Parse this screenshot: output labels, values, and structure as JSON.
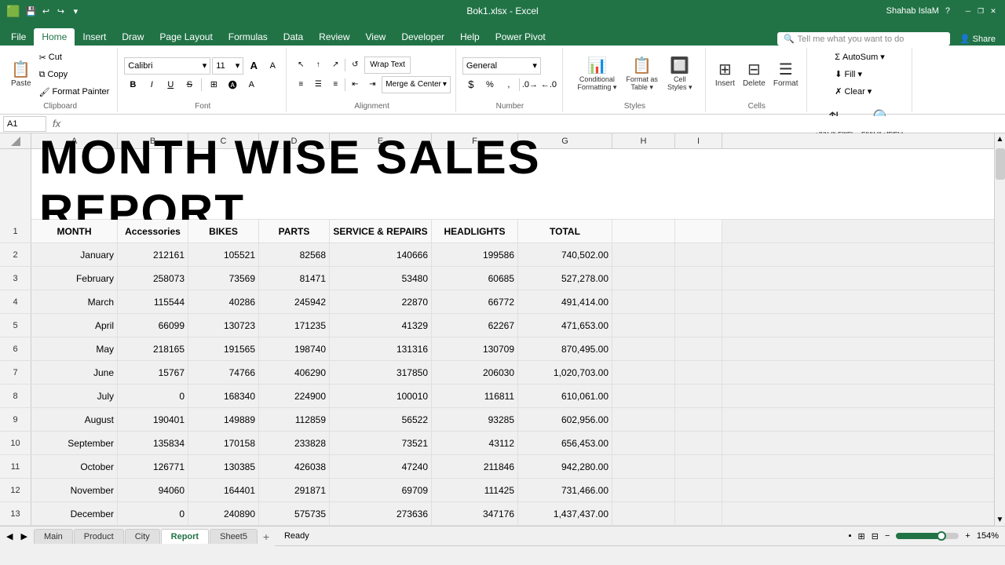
{
  "titlebar": {
    "filename": "Bok1.xlsx - Excel",
    "user": "Shahab IslaM",
    "quickaccess": [
      "save",
      "undo",
      "redo",
      "customize"
    ]
  },
  "ribbon": {
    "tabs": [
      "File",
      "Home",
      "Insert",
      "Draw",
      "Page Layout",
      "Formulas",
      "Data",
      "Review",
      "View",
      "Developer",
      "Help",
      "Power Pivot"
    ],
    "active_tab": "Home",
    "search_placeholder": "Tell me what you want to do",
    "share": "Share",
    "font": {
      "name": "Calibri",
      "size": "11",
      "grow": "A",
      "shrink": "A"
    },
    "clipboard": {
      "paste": "Paste",
      "cut": "Cut",
      "copy": "Copy",
      "format_painter": "Format Painter"
    },
    "alignment": {
      "wrap_text": "Wrap Text",
      "merge_center": "Merge & Center"
    },
    "number": {
      "format": "General",
      "currency": "$",
      "percent": "%",
      "comma": ","
    },
    "cells": {
      "insert": "Insert",
      "delete": "Delete",
      "format": "Format"
    },
    "editing": {
      "autosum": "AutoSum",
      "fill": "Fill",
      "clear": "Clear",
      "sort_filter": "Sort & Filter",
      "find_select": "Find & Select"
    }
  },
  "formula_bar": {
    "cell_ref": "A1",
    "formula": ""
  },
  "spreadsheet": {
    "col_headers": [
      "A",
      "B",
      "C",
      "D",
      "E",
      "F",
      "G",
      "H",
      "I"
    ],
    "title": "MONTH WISE   SALES REPORT",
    "headers": [
      "MONTH",
      "Accessories",
      "BIKES",
      "PARTS",
      "SERVICE & REPAIRS",
      "HEADLIGHTS",
      "TOTAL",
      "",
      ""
    ],
    "rows": [
      {
        "num": 2,
        "month": "January",
        "acc": "212161",
        "bikes": "105521",
        "parts": "82568",
        "service": "140666",
        "head": "199586",
        "total": "740,502.00"
      },
      {
        "num": 3,
        "month": "February",
        "acc": "258073",
        "bikes": "73569",
        "parts": "81471",
        "service": "53480",
        "head": "60685",
        "total": "527,278.00"
      },
      {
        "num": 4,
        "month": "March",
        "acc": "115544",
        "bikes": "40286",
        "parts": "245942",
        "service": "22870",
        "head": "66772",
        "total": "491,414.00"
      },
      {
        "num": 5,
        "month": "April",
        "acc": "66099",
        "bikes": "130723",
        "parts": "171235",
        "service": "41329",
        "head": "62267",
        "total": "471,653.00"
      },
      {
        "num": 6,
        "month": "May",
        "acc": "218165",
        "bikes": "191565",
        "parts": "198740",
        "service": "131316",
        "head": "130709",
        "total": "870,495.00"
      },
      {
        "num": 7,
        "month": "June",
        "acc": "15767",
        "bikes": "74766",
        "parts": "406290",
        "service": "317850",
        "head": "206030",
        "total": "1,020,703.00"
      },
      {
        "num": 8,
        "month": "July",
        "acc": "0",
        "bikes": "168340",
        "parts": "224900",
        "service": "100010",
        "head": "116811",
        "total": "610,061.00"
      },
      {
        "num": 9,
        "month": "August",
        "acc": "190401",
        "bikes": "149889",
        "parts": "112859",
        "service": "56522",
        "head": "93285",
        "total": "602,956.00"
      },
      {
        "num": 10,
        "month": "September",
        "acc": "135834",
        "bikes": "170158",
        "parts": "233828",
        "service": "73521",
        "head": "43112",
        "total": "656,453.00"
      },
      {
        "num": 11,
        "month": "October",
        "acc": "126771",
        "bikes": "130385",
        "parts": "426038",
        "service": "47240",
        "head": "211846",
        "total": "942,280.00"
      },
      {
        "num": 12,
        "month": "November",
        "acc": "94060",
        "bikes": "164401",
        "parts": "291871",
        "service": "69709",
        "head": "111425",
        "total": "731,466.00"
      },
      {
        "num": 13,
        "month": "December",
        "acc": "0",
        "bikes": "240890",
        "parts": "575735",
        "service": "273636",
        "head": "347176",
        "total": "1,437,437.00"
      }
    ]
  },
  "sheet_tabs": [
    "Main",
    "Product",
    "City",
    "Report",
    "Sheet5"
  ],
  "active_sheet": "Report",
  "status": {
    "left": "Ready",
    "zoom": "154%"
  }
}
